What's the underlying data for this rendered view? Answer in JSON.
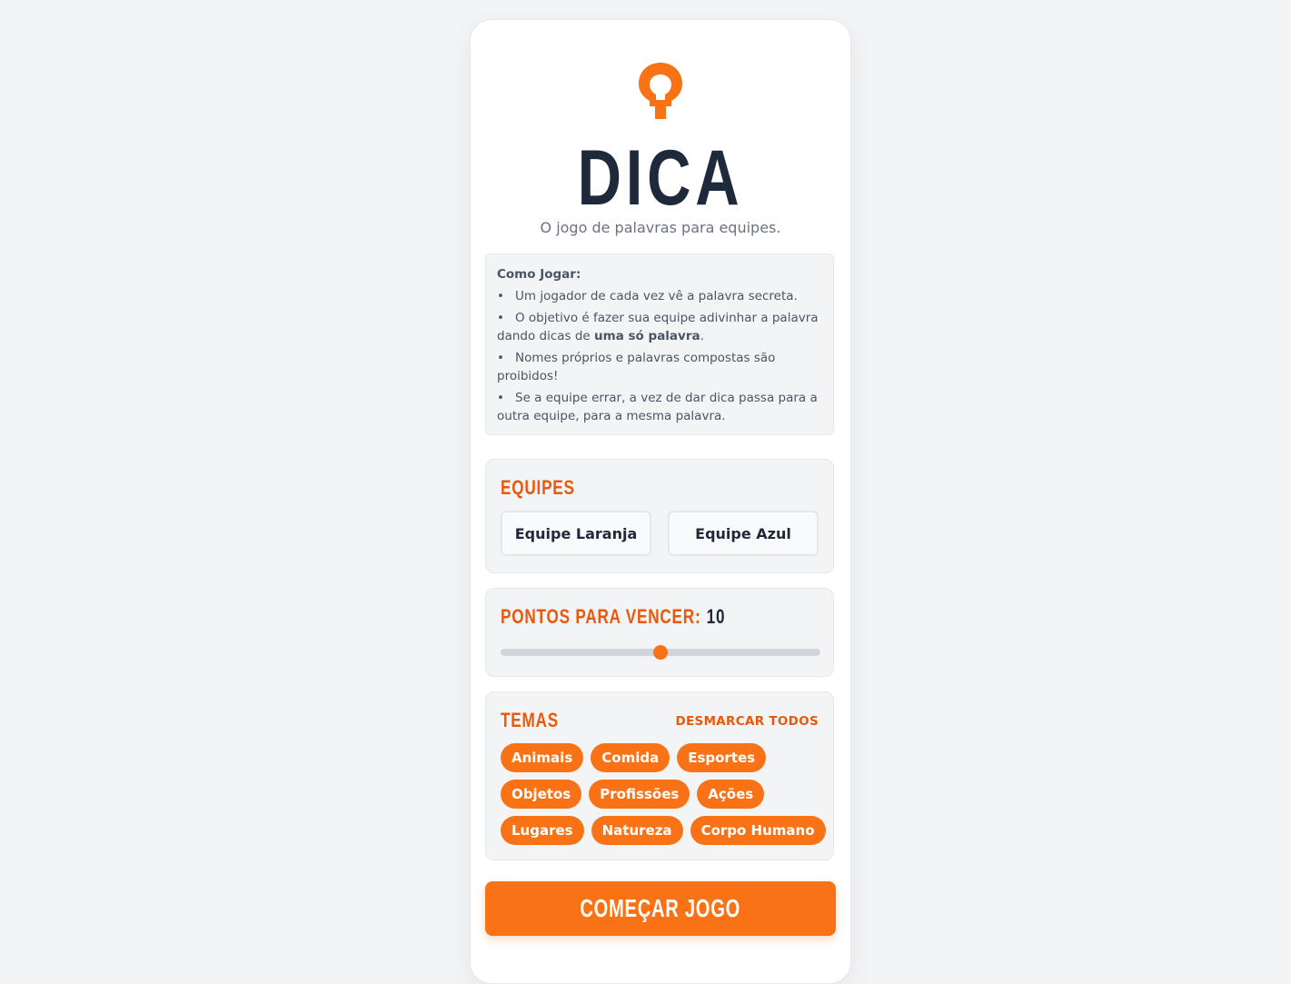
{
  "app": {
    "title": "DICA",
    "subtitle": "O jogo de palavras para equipes.",
    "accent_color": "#f97316",
    "logo_icon": "lightbulb-icon"
  },
  "rules": {
    "heading": "Como Jogar:",
    "items": [
      "Um jogador de cada vez vê a palavra secreta.",
      "O objetivo é fazer sua equipe adivinhar a palavra dando dicas de ",
      "Nomes próprios e palavras compostas são proibidos!",
      "Se a equipe errar, a vez de dar dica passa para a outra equipe, para a mesma palavra."
    ],
    "item2_bold": "uma só palavra",
    "item2_end": ".",
    "bullet": "•"
  },
  "teams": {
    "title": "EQUIPES",
    "team_1": "Equipe Laranja",
    "team_2": "Equipe Azul"
  },
  "points": {
    "title": "PONTOS PARA VENCER:",
    "value": "10",
    "slider_fraction": 0.5
  },
  "themes": {
    "title": "TEMAS",
    "deselect_all": "DESMARCAR TODOS",
    "chips": [
      "Animais",
      "Comida",
      "Esportes",
      "Objetos",
      "Profissões",
      "Ações",
      "Lugares",
      "Natureza",
      "Corpo Humano"
    ]
  },
  "start": {
    "label": "COMEÇAR JOGO"
  }
}
